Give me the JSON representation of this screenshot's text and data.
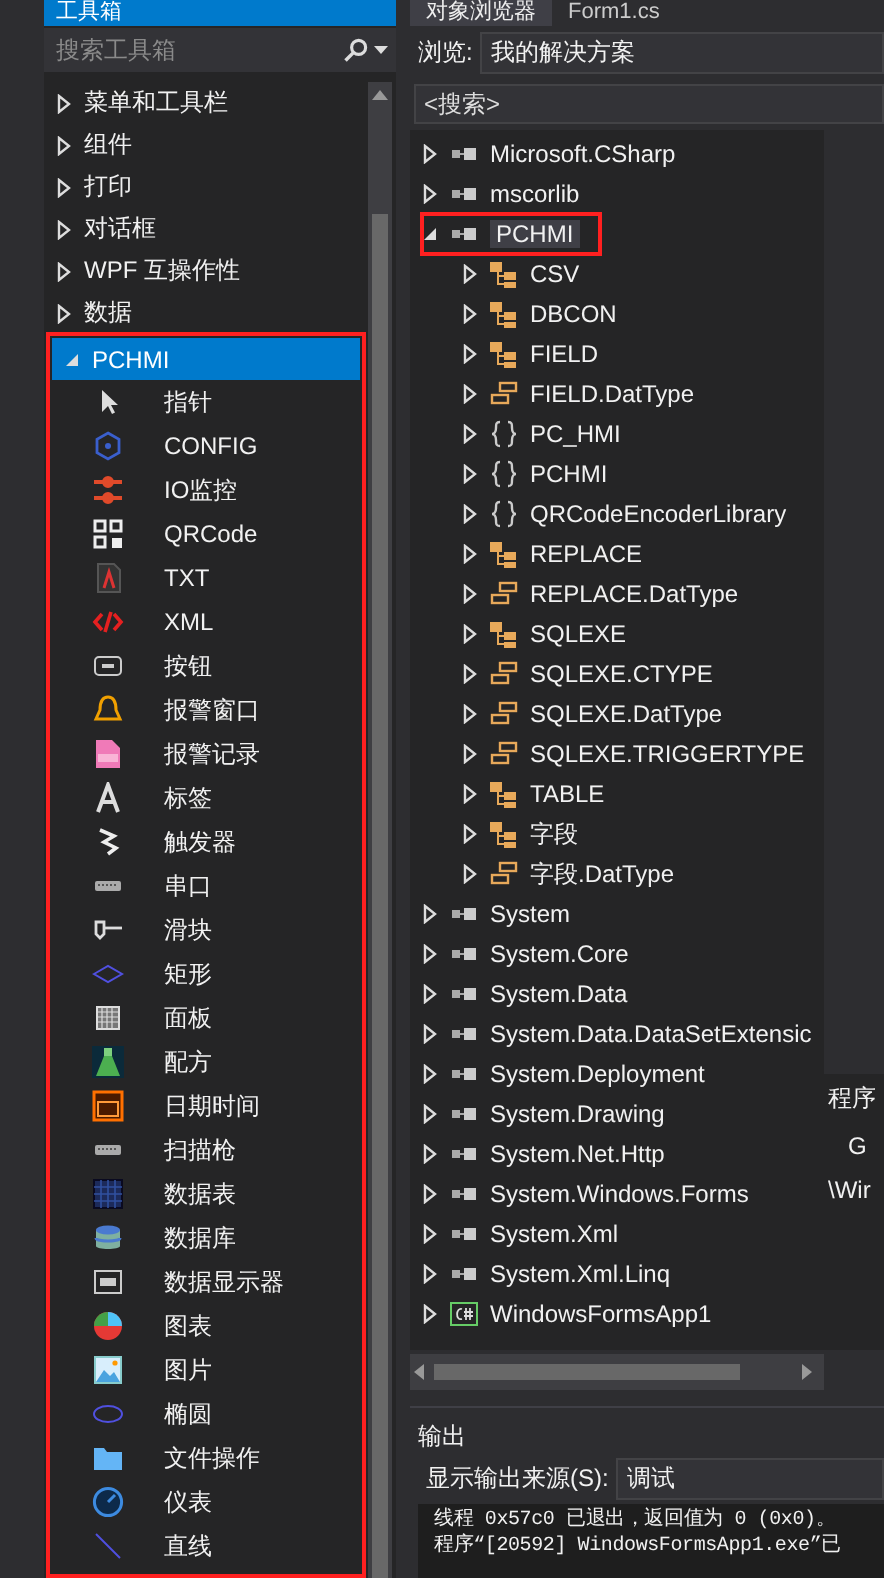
{
  "toolbox": {
    "title": "工具箱",
    "search": {
      "placeholder": "搜索工具箱"
    },
    "categories": [
      {
        "label": "菜单和工具栏",
        "expanded": false,
        "selected": false,
        "highlighted": false
      },
      {
        "label": "组件",
        "expanded": false,
        "selected": false,
        "highlighted": false
      },
      {
        "label": "打印",
        "expanded": false,
        "selected": false,
        "highlighted": false
      },
      {
        "label": "对话框",
        "expanded": false,
        "selected": false,
        "highlighted": false
      },
      {
        "label": "WPF 互操作性",
        "expanded": false,
        "selected": false,
        "highlighted": false
      },
      {
        "label": "数据",
        "expanded": false,
        "selected": false,
        "highlighted": false
      },
      {
        "label": "PCHMI",
        "expanded": true,
        "selected": true,
        "highlighted": true,
        "items": [
          {
            "label": "指针",
            "kind": "pointer"
          },
          {
            "label": "CONFIG",
            "kind": "config"
          },
          {
            "label": "IO监控",
            "kind": "io"
          },
          {
            "label": "QRCode",
            "kind": "qrcode"
          },
          {
            "label": "TXT",
            "kind": "txt"
          },
          {
            "label": "XML",
            "kind": "xml"
          },
          {
            "label": "按钮",
            "kind": "button"
          },
          {
            "label": "报警窗口",
            "kind": "alarm"
          },
          {
            "label": "报警记录",
            "kind": "log"
          },
          {
            "label": "标签",
            "kind": "label"
          },
          {
            "label": "触发器",
            "kind": "trigger"
          },
          {
            "label": "串口",
            "kind": "serial"
          },
          {
            "label": "滑块",
            "kind": "slider"
          },
          {
            "label": "矩形",
            "kind": "rect"
          },
          {
            "label": "面板",
            "kind": "panel"
          },
          {
            "label": "配方",
            "kind": "recipe"
          },
          {
            "label": "日期时间",
            "kind": "datetime"
          },
          {
            "label": "扫描枪",
            "kind": "serial"
          },
          {
            "label": "数据表",
            "kind": "datatable"
          },
          {
            "label": "数据库",
            "kind": "database"
          },
          {
            "label": "数据显示器",
            "kind": "datadisplay"
          },
          {
            "label": "图表",
            "kind": "chart"
          },
          {
            "label": "图片",
            "kind": "image"
          },
          {
            "label": "椭圆",
            "kind": "ellipse"
          },
          {
            "label": "文件操作",
            "kind": "folder"
          },
          {
            "label": "仪表",
            "kind": "gauge"
          },
          {
            "label": "直线",
            "kind": "line"
          }
        ]
      }
    ]
  },
  "object_browser": {
    "tabs": [
      {
        "label": "对象浏览器",
        "selected": true
      },
      {
        "label": "Form1.cs",
        "selected": false
      }
    ],
    "browse": {
      "label": "浏览:",
      "value": "我的解决方案"
    },
    "search": {
      "placeholder": "<搜索>"
    },
    "tree": [
      {
        "label": "Microsoft.CSharp",
        "kind": "assembly",
        "expanded": false,
        "selected": false,
        "highlighted": false
      },
      {
        "label": "mscorlib",
        "kind": "assembly",
        "expanded": false,
        "selected": false,
        "highlighted": false
      },
      {
        "label": "PCHMI",
        "kind": "assembly",
        "expanded": true,
        "selected": true,
        "highlighted": true,
        "children": [
          {
            "label": "CSV",
            "kind": "class",
            "expanded": false,
            "selected": false,
            "highlighted": false
          },
          {
            "label": "DBCON",
            "kind": "class",
            "expanded": false,
            "selected": false,
            "highlighted": false
          },
          {
            "label": "FIELD",
            "kind": "class",
            "expanded": false,
            "selected": false,
            "highlighted": false
          },
          {
            "label": "FIELD.DatType",
            "kind": "enum",
            "expanded": false,
            "selected": false,
            "highlighted": false
          },
          {
            "label": "PC_HMI",
            "kind": "namespace",
            "expanded": false,
            "selected": false,
            "highlighted": false
          },
          {
            "label": "PCHMI",
            "kind": "namespace",
            "expanded": false,
            "selected": false,
            "highlighted": false
          },
          {
            "label": "QRCodeEncoderLibrary",
            "kind": "namespace",
            "expanded": false,
            "selected": false,
            "highlighted": false
          },
          {
            "label": "REPLACE",
            "kind": "class",
            "expanded": false,
            "selected": false,
            "highlighted": false
          },
          {
            "label": "REPLACE.DatType",
            "kind": "enum",
            "expanded": false,
            "selected": false,
            "highlighted": false
          },
          {
            "label": "SQLEXE",
            "kind": "class",
            "expanded": false,
            "selected": false,
            "highlighted": false
          },
          {
            "label": "SQLEXE.CTYPE",
            "kind": "enum",
            "expanded": false,
            "selected": false,
            "highlighted": false
          },
          {
            "label": "SQLEXE.DatType",
            "kind": "enum",
            "expanded": false,
            "selected": false,
            "highlighted": false
          },
          {
            "label": "SQLEXE.TRIGGERTYPE",
            "kind": "enum",
            "expanded": false,
            "selected": false,
            "highlighted": false
          },
          {
            "label": "TABLE",
            "kind": "class",
            "expanded": false,
            "selected": false,
            "highlighted": false
          },
          {
            "label": "字段",
            "kind": "class",
            "expanded": false,
            "selected": false,
            "highlighted": false
          },
          {
            "label": "字段.DatType",
            "kind": "enum",
            "expanded": false,
            "selected": false,
            "highlighted": false
          }
        ]
      },
      {
        "label": "System",
        "kind": "assembly",
        "expanded": false,
        "selected": false,
        "highlighted": false
      },
      {
        "label": "System.Core",
        "kind": "assembly",
        "expanded": false,
        "selected": false,
        "highlighted": false
      },
      {
        "label": "System.Data",
        "kind": "assembly",
        "expanded": false,
        "selected": false,
        "highlighted": false
      },
      {
        "label": "System.Data.DataSetExtensic",
        "kind": "assembly",
        "expanded": false,
        "selected": false,
        "highlighted": false
      },
      {
        "label": "System.Deployment",
        "kind": "assembly",
        "expanded": false,
        "selected": false,
        "highlighted": false
      },
      {
        "label": "System.Drawing",
        "kind": "assembly",
        "expanded": false,
        "selected": false,
        "highlighted": false
      },
      {
        "label": "System.Net.Http",
        "kind": "assembly",
        "expanded": false,
        "selected": false,
        "highlighted": false
      },
      {
        "label": "System.Windows.Forms",
        "kind": "assembly",
        "expanded": false,
        "selected": false,
        "highlighted": false
      },
      {
        "label": "System.Xml",
        "kind": "assembly",
        "expanded": false,
        "selected": false,
        "highlighted": false
      },
      {
        "label": "System.Xml.Linq",
        "kind": "assembly",
        "expanded": false,
        "selected": false,
        "highlighted": false
      },
      {
        "label": "WindowsFormsApp1",
        "kind": "project",
        "expanded": false,
        "selected": false,
        "highlighted": false
      }
    ],
    "details": [
      "程序",
      "G",
      "\\Wir"
    ]
  },
  "output": {
    "title": "输出",
    "source_label": "显示输出来源(S):",
    "source_value": "调试",
    "lines": [
      "线程 0x57c0 已退出，返回值为 0 (0x0)。",
      "程序“[20592] WindowsFormsApp1.exe”已"
    ]
  }
}
